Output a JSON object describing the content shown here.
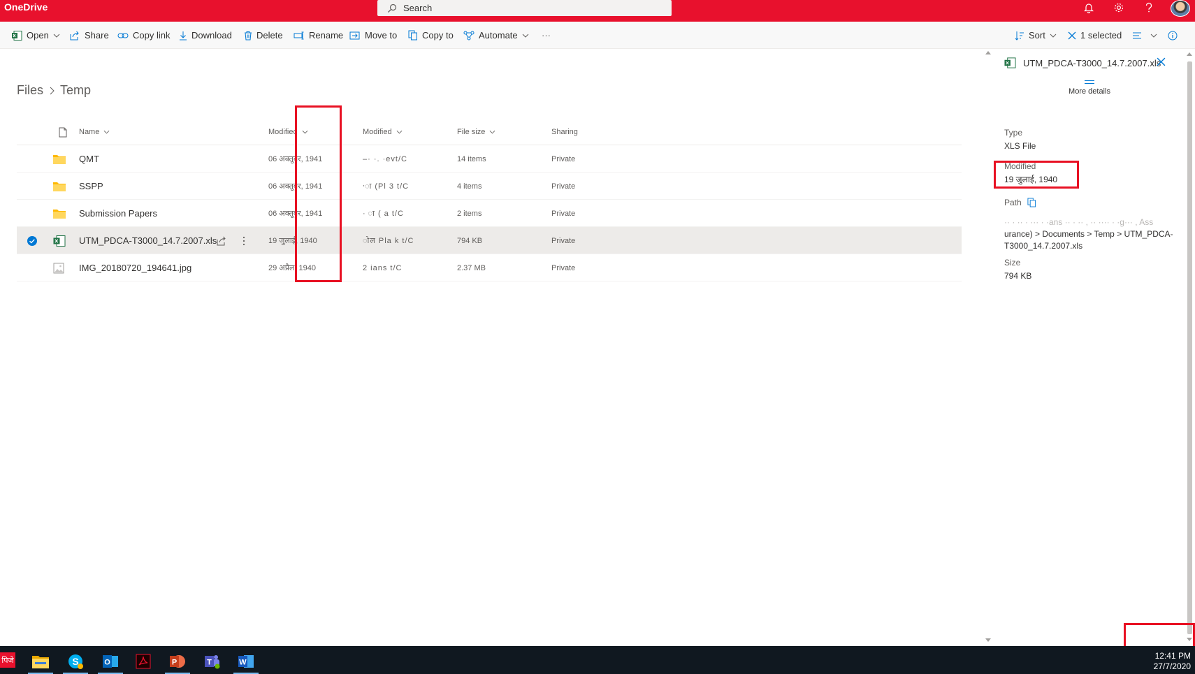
{
  "app": {
    "title": "OneDrive"
  },
  "search": {
    "placeholder": "Search"
  },
  "commands": {
    "open": "Open",
    "share": "Share",
    "copy_link": "Copy link",
    "download": "Download",
    "delete": "Delete",
    "rename": "Rename",
    "move_to": "Move to",
    "copy_to": "Copy to",
    "automate": "Automate",
    "more": "···",
    "sort": "Sort",
    "selected": "1 selected"
  },
  "breadcrumb": {
    "root": "Files",
    "current": "Temp"
  },
  "table": {
    "headers": {
      "name": "Name",
      "modified": "Modified",
      "modified_by": "Modified",
      "file_size": "File size",
      "sharing": "Sharing"
    },
    "rows": [
      {
        "name": "QMT",
        "type": "folder",
        "modified": "06 अक्तूबर, 1941",
        "modified_by": "–·  ·.  ·evt/C",
        "size": "14 items",
        "sharing": "Private",
        "selected": false
      },
      {
        "name": "SSPP",
        "type": "folder",
        "modified": "06 अक्तूबर, 1941",
        "modified_by": "·ा  (Pl   3  t/C",
        "size": "4 items",
        "sharing": "Private",
        "selected": false
      },
      {
        "name": "Submission Papers",
        "type": "folder",
        "modified": "06 अक्तूबर, 1941",
        "modified_by": "·  ा  (  a   t/C",
        "size": "2 items",
        "sharing": "Private",
        "selected": false
      },
      {
        "name": "UTM_PDCA-T3000_14.7.2007.xls",
        "type": "excel",
        "modified": "19 जुलाई, 1940",
        "modified_by": "ोल  Pla  k  t/C",
        "size": "794 KB",
        "sharing": "Private",
        "selected": true
      },
      {
        "name": "IMG_20180720_194641.jpg",
        "type": "image",
        "modified": "29 अप्रैल, 1940",
        "modified_by": "2    ians   t/C",
        "size": "2.37 MB",
        "sharing": "Private",
        "selected": false
      }
    ]
  },
  "details": {
    "file_name": "UTM_PDCA-T3000_14.7.2007.xls",
    "more_details": "More details",
    "type_label": "Type",
    "type_value": "XLS File",
    "modified_label": "Modified",
    "modified_value": "19 जुलाई, 1940",
    "path_label": "Path",
    "path_blur": "·· · ·· · ··· · ·ans ·· · ·· , ·· ···· · ·g··· , Ass",
    "path_value": "urance) > Documents > Temp > UTM_PDCA-T3000_14.7.2007.xls",
    "size_label": "Size",
    "size_value": "794 KB"
  },
  "taskbar": {
    "start": "पिजे",
    "time": "12:41 PM",
    "date": "27/7/2020"
  },
  "colors": {
    "brand": "#e8112d",
    "accent": "#0078d4",
    "highlight": "#e81123"
  }
}
